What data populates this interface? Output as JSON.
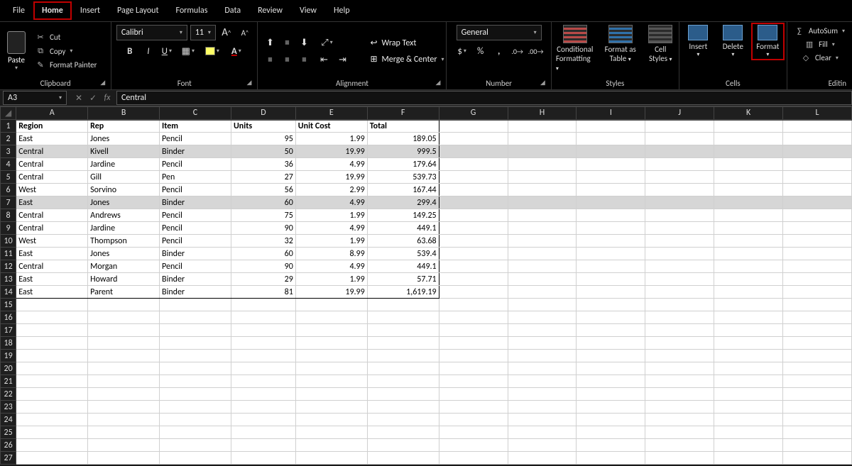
{
  "menu": {
    "items": [
      "File",
      "Home",
      "Insert",
      "Page Layout",
      "Formulas",
      "Data",
      "Review",
      "View",
      "Help"
    ],
    "active": "Home"
  },
  "ribbon": {
    "clipboard": {
      "label": "Clipboard",
      "paste": "Paste",
      "cut": "Cut",
      "copy": "Copy",
      "format_painter": "Format Painter"
    },
    "font": {
      "label": "Font",
      "name": "Calibri",
      "size": "11",
      "increase": "A",
      "decrease": "A",
      "bold": "B",
      "italic": "I",
      "underline": "U",
      "font_color_letter": "A"
    },
    "alignment": {
      "label": "Alignment",
      "wrap": "Wrap Text",
      "merge": "Merge & Center"
    },
    "number": {
      "label": "Number",
      "format": "General",
      "currency": "$",
      "percent": "%",
      "comma": ","
    },
    "styles": {
      "label": "Styles",
      "cond_fmt_l1": "Conditional",
      "cond_fmt_l2": "Formatting",
      "fmt_table_l1": "Format as",
      "fmt_table_l2": "Table",
      "cell_styles_l1": "Cell",
      "cell_styles_l2": "Styles"
    },
    "cells": {
      "label": "Cells",
      "insert": "Insert",
      "delete": "Delete",
      "format": "Format"
    },
    "editing": {
      "label": "Editin",
      "autosum": "AutoSum",
      "fill": "Fill",
      "clear": "Clear"
    }
  },
  "namebox": "A3",
  "formula": "Central",
  "columns": [
    "A",
    "B",
    "C",
    "D",
    "E",
    "F",
    "G",
    "H",
    "I",
    "J",
    "K",
    "L"
  ],
  "chart_data": {
    "type": "table",
    "headers": [
      "Region",
      "Rep",
      "Item",
      "Units",
      "Unit Cost",
      "Total"
    ],
    "rows": [
      [
        "East",
        "Jones",
        "Pencil",
        95,
        1.99,
        189.05
      ],
      [
        "Central",
        "Kivell",
        "Binder",
        50,
        19.99,
        999.5
      ],
      [
        "Central",
        "Jardine",
        "Pencil",
        36,
        4.99,
        179.64
      ],
      [
        "Central",
        "Gill",
        "Pen",
        27,
        19.99,
        539.73
      ],
      [
        "West",
        "Sorvino",
        "Pencil",
        56,
        2.99,
        167.44
      ],
      [
        "East",
        "Jones",
        "Binder",
        60,
        4.99,
        299.4
      ],
      [
        "Central",
        "Andrews",
        "Pencil",
        75,
        1.99,
        149.25
      ],
      [
        "Central",
        "Jardine",
        "Pencil",
        90,
        4.99,
        449.1
      ],
      [
        "West",
        "Thompson",
        "Pencil",
        32,
        1.99,
        63.68
      ],
      [
        "East",
        "Jones",
        "Binder",
        60,
        8.99,
        539.4
      ],
      [
        "Central",
        "Morgan",
        "Pencil",
        90,
        4.99,
        449.1
      ],
      [
        "East",
        "Howard",
        "Binder",
        29,
        1.99,
        57.71
      ],
      [
        "East",
        "Parent",
        "Binder",
        81,
        19.99,
        "1,619.19"
      ]
    ],
    "selected_rows": [
      3,
      7
    ],
    "empty_rows_after": 13
  }
}
